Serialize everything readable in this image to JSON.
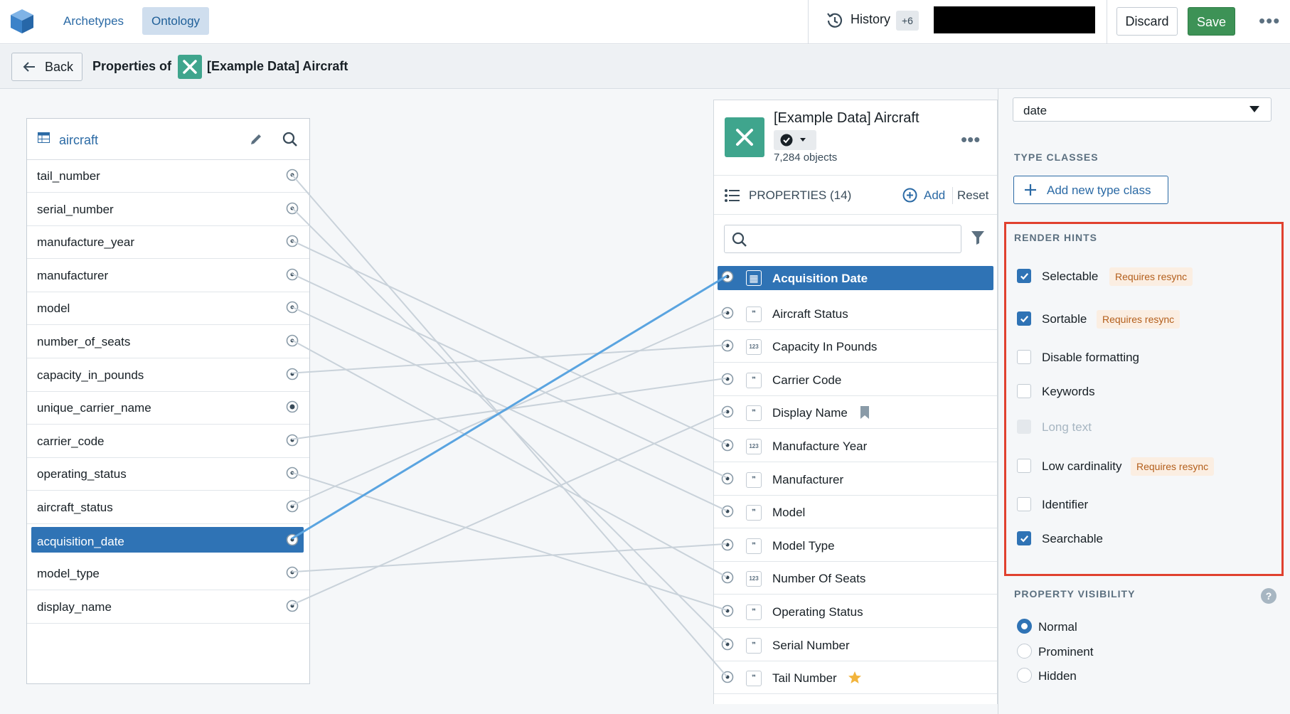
{
  "topbar": {
    "tabs": [
      {
        "label": "Archetypes"
      },
      {
        "label": "Ontology"
      }
    ],
    "history_label": "History",
    "history_count": "+6",
    "discard_label": "Discard",
    "save_label": "Save",
    "more_label": "•••"
  },
  "subheader": {
    "back_label": "Back",
    "properties_of": "Properties of",
    "object_name": "[Example Data] Aircraft"
  },
  "dataset": {
    "name": "aircraft",
    "columns": [
      "tail_number",
      "serial_number",
      "manufacture_year",
      "manufacturer",
      "model",
      "number_of_seats",
      "capacity_in_pounds",
      "unique_carrier_name",
      "carrier_code",
      "operating_status",
      "aircraft_status",
      "acquisition_date",
      "model_type",
      "display_name"
    ],
    "selected_column": "acquisition_date"
  },
  "object": {
    "title": "[Example Data] Aircraft",
    "count": "7,284 objects",
    "more_label": "•••",
    "properties_label": "PROPERTIES (14)",
    "add_label": "Add",
    "reset_label": "Reset",
    "properties": [
      {
        "name": "Acquisition Date",
        "type": "date-icon"
      },
      {
        "name": "Aircraft Status",
        "type": "string-icon"
      },
      {
        "name": "Capacity In Pounds",
        "type": "number-icon"
      },
      {
        "name": "Carrier Code",
        "type": "string-icon"
      },
      {
        "name": "Display Name",
        "type": "string-icon",
        "badge": "bookmark-icon"
      },
      {
        "name": "Manufacture Year",
        "type": "number-icon"
      },
      {
        "name": "Manufacturer",
        "type": "string-icon"
      },
      {
        "name": "Model",
        "type": "string-icon"
      },
      {
        "name": "Model Type",
        "type": "string-icon"
      },
      {
        "name": "Number Of Seats",
        "type": "number-icon"
      },
      {
        "name": "Operating Status",
        "type": "string-icon"
      },
      {
        "name": "Serial Number",
        "type": "string-icon"
      },
      {
        "name": "Tail Number",
        "type": "string-icon",
        "badge": "star-icon"
      }
    ],
    "selected_property": "Acquisition Date"
  },
  "mappings": [
    [
      "tail_number",
      "Tail Number"
    ],
    [
      "serial_number",
      "Serial Number"
    ],
    [
      "manufacture_year",
      "Manufacture Year"
    ],
    [
      "manufacturer",
      "Manufacturer"
    ],
    [
      "model",
      "Model"
    ],
    [
      "number_of_seats",
      "Number Of Seats"
    ],
    [
      "capacity_in_pounds",
      "Capacity In Pounds"
    ],
    [
      "carrier_code",
      "Carrier Code"
    ],
    [
      "operating_status",
      "Operating Status"
    ],
    [
      "aircraft_status",
      "Aircraft Status"
    ],
    [
      "acquisition_date",
      "Acquisition Date"
    ],
    [
      "model_type",
      "Model Type"
    ],
    [
      "display_name",
      "Display Name"
    ]
  ],
  "settings": {
    "base_type": "date",
    "type_classes_title": "TYPE CLASSES",
    "add_type_class_label": "Add new type class",
    "render_hints_title": "RENDER HINTS",
    "requires_resync_label": "Requires resync",
    "render_hints": [
      {
        "label": "Selectable",
        "checked": true,
        "resync": true
      },
      {
        "label": "Sortable",
        "checked": true,
        "resync": true
      },
      {
        "label": "Disable formatting",
        "checked": false,
        "resync": false
      },
      {
        "label": "Keywords",
        "checked": false,
        "resync": false
      },
      {
        "label": "Long text",
        "checked": false,
        "resync": false,
        "disabled": true
      },
      {
        "label": "Low cardinality",
        "checked": false,
        "resync": true
      },
      {
        "label": "Identifier",
        "checked": false,
        "resync": false
      },
      {
        "label": "Searchable",
        "checked": true,
        "resync": false
      }
    ],
    "visibility_title": "PROPERTY VISIBILITY",
    "help_label": "?",
    "visibility_options": [
      {
        "label": "Normal",
        "selected": true
      },
      {
        "label": "Prominent",
        "selected": false
      },
      {
        "label": "Hidden",
        "selected": false
      }
    ]
  },
  "colors": {
    "accent": "#2f73b5",
    "object_icon": "#3fa58d",
    "save": "#3d9256",
    "highlight_box": "#e0412f",
    "resync_bg": "#fbeee2",
    "resync_text": "#b35e1b",
    "wire": "#c9d2da",
    "wire_selected": "#5aa4e0"
  }
}
